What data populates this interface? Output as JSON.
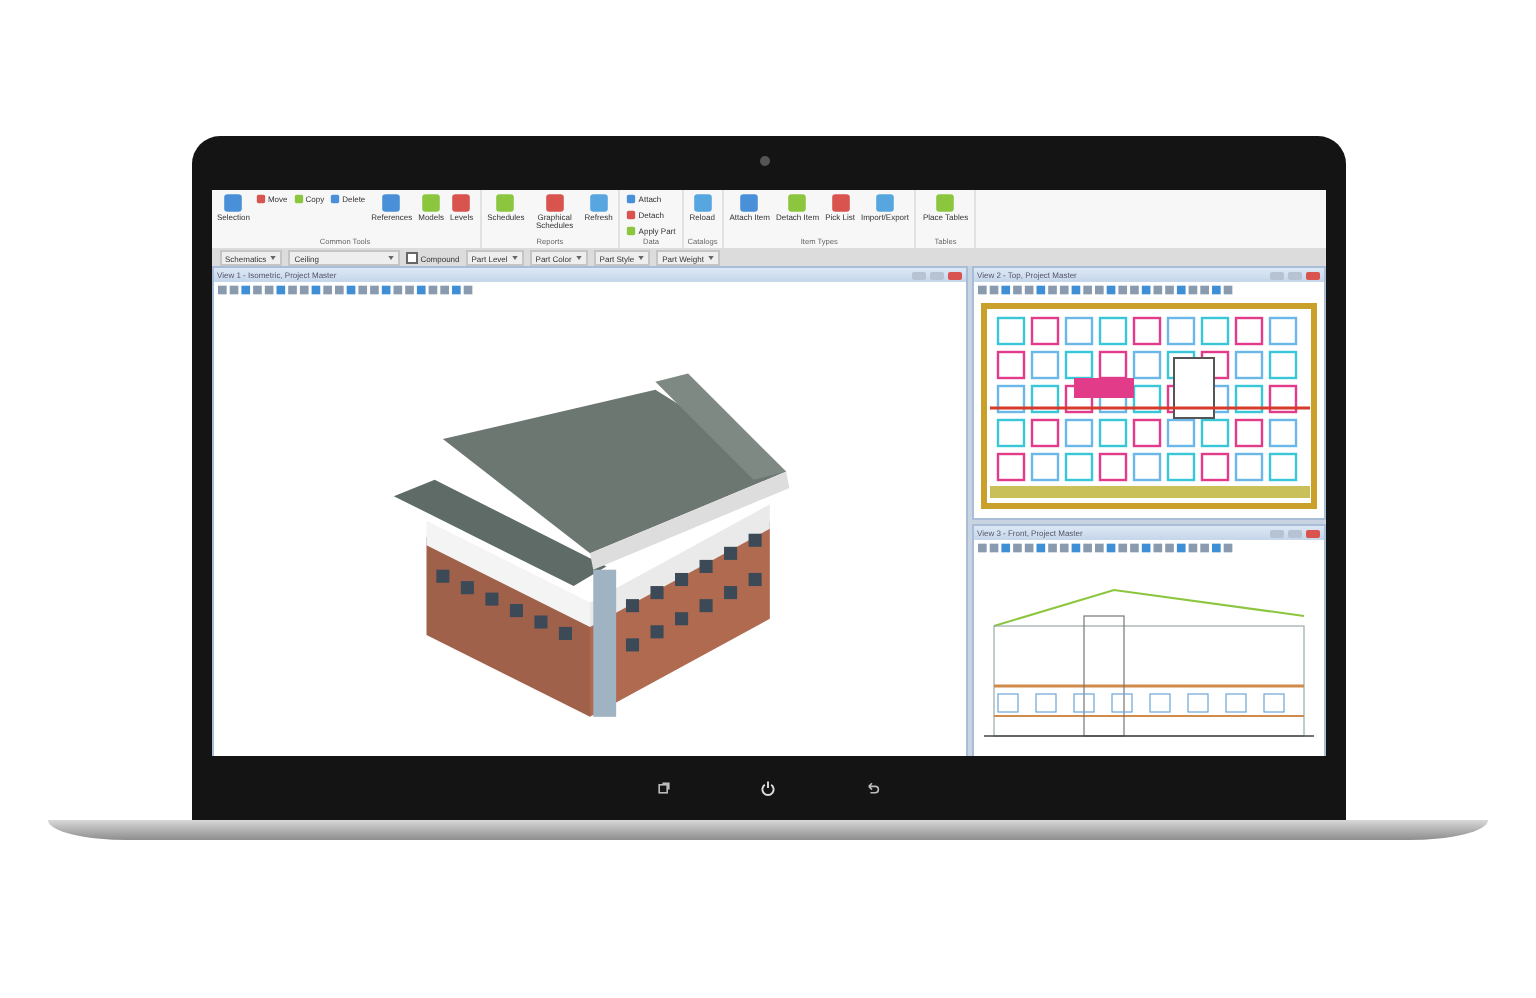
{
  "ribbon": {
    "groups": [
      {
        "label": "Common Tools",
        "buttons": [
          {
            "label": "Selection",
            "kind": "large"
          },
          {
            "label": "Move",
            "kind": "small"
          },
          {
            "label": "Copy",
            "kind": "small"
          },
          {
            "label": "Delete",
            "kind": "small"
          },
          {
            "label": "References",
            "kind": "large"
          },
          {
            "label": "Models",
            "kind": "large"
          },
          {
            "label": "Levels",
            "kind": "large"
          }
        ]
      },
      {
        "label": "Reports",
        "buttons": [
          {
            "label": "Schedules",
            "kind": "large"
          },
          {
            "label": "Graphical Schedules",
            "kind": "large"
          },
          {
            "label": "Refresh",
            "kind": "large"
          }
        ]
      },
      {
        "label": "Data",
        "buttons": [
          {
            "label": "Attach",
            "kind": "small"
          },
          {
            "label": "Detach",
            "kind": "small"
          },
          {
            "label": "Apply Part",
            "kind": "small"
          }
        ]
      },
      {
        "label": "Catalogs",
        "buttons": [
          {
            "label": "Reload",
            "kind": "large"
          }
        ]
      },
      {
        "label": "Item Types",
        "buttons": [
          {
            "label": "Attach Item",
            "kind": "large"
          },
          {
            "label": "Detach Item",
            "kind": "large"
          },
          {
            "label": "Pick List",
            "kind": "large"
          },
          {
            "label": "Import/Export",
            "kind": "large"
          }
        ]
      },
      {
        "label": "Tables",
        "buttons": [
          {
            "label": "Place Tables",
            "kind": "large"
          }
        ]
      }
    ]
  },
  "toolbar": {
    "items": [
      {
        "kind": "dropdown",
        "value": "Schematics"
      },
      {
        "kind": "dropdown",
        "value": "Ceiling"
      },
      {
        "kind": "checkbox",
        "label": "Compound",
        "checked": false
      },
      {
        "kind": "dropdown",
        "value": "Part Level"
      },
      {
        "kind": "dropdown",
        "value": "Part Color"
      },
      {
        "kind": "dropdown",
        "value": "Part Style"
      },
      {
        "kind": "dropdown",
        "value": "Part Weight"
      }
    ]
  },
  "views": [
    {
      "title": "View 1 - Isometric, Project Master",
      "kind": "isometric"
    },
    {
      "title": "View 2 - Top, Project Master",
      "kind": "plan"
    },
    {
      "title": "View 3 - Front, Project Master",
      "kind": "elevation"
    }
  ]
}
